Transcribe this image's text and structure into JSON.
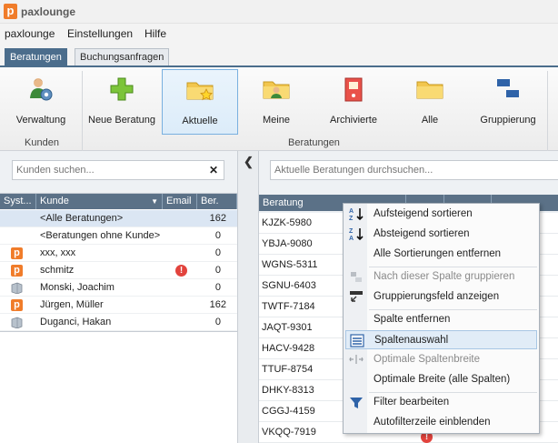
{
  "app": {
    "title": "paxlounge",
    "icon_letter": "p"
  },
  "menu": [
    "paxlounge",
    "Einstellungen",
    "Hilfe"
  ],
  "tabs": [
    {
      "label": "Beratungen",
      "active": true
    },
    {
      "label": "Buchungsanfragen",
      "active": false
    }
  ],
  "ribbon": {
    "buttons": [
      {
        "label": "Verwaltung",
        "icon": "user-gear-icon"
      },
      {
        "label": "Neue Beratung",
        "icon": "green-plus-icon"
      },
      {
        "label": "Aktuelle",
        "icon": "folder-star-icon",
        "selected": true
      },
      {
        "label": "Meine",
        "icon": "folder-person-icon"
      },
      {
        "label": "Archivierte",
        "icon": "binder-icon"
      },
      {
        "label": "Alle",
        "icon": "folder-icon"
      },
      {
        "label": "Gruppierung",
        "icon": "grouping-icon"
      }
    ],
    "groups": [
      "Kunden",
      "Beratungen"
    ]
  },
  "customers": {
    "search_placeholder": "Kunden suchen...",
    "columns": [
      "Syst...",
      "Kunde",
      "Email",
      "Ber."
    ],
    "rows": [
      {
        "system": "",
        "name": "<Alle Beratungen>",
        "email_warning": false,
        "count": "162"
      },
      {
        "system": "",
        "name": "<Beratungen ohne Kunde>",
        "email_warning": false,
        "count": "0"
      },
      {
        "system": "paxlounge",
        "name": "xxx, xxx",
        "email_warning": false,
        "count": "0"
      },
      {
        "system": "paxlounge",
        "name": "schmitz",
        "email_warning": true,
        "count": "0"
      },
      {
        "system": "other",
        "name": "Monski, Joachim",
        "email_warning": false,
        "count": "0"
      },
      {
        "system": "paxlounge",
        "name": "Jürgen, Müller",
        "email_warning": false,
        "count": "162"
      },
      {
        "system": "other",
        "name": "Duganci, Hakan",
        "email_warning": false,
        "count": "0"
      }
    ]
  },
  "consultations": {
    "search_placeholder": "Aktuelle Beratungen durchsuchen...",
    "columns": [
      "Beratung"
    ],
    "rows": [
      "KJZK-5980",
      "YBJA-9080",
      "WGNS-5311",
      "SGNU-6403",
      "TWTF-7184",
      "JAQT-9301",
      "HACV-9428",
      "TTUF-8754",
      "DHKY-8313",
      "CGGJ-4159",
      "VKQQ-7919"
    ]
  },
  "context_menu": {
    "items": [
      {
        "label": "Aufsteigend sortieren",
        "icon": "sort-ascending-icon",
        "disabled": false
      },
      {
        "label": "Absteigend sortieren",
        "icon": "sort-descending-icon",
        "disabled": false
      },
      {
        "label": "Alle Sortierungen entfernen",
        "icon": "",
        "disabled": false
      },
      {
        "label": "Nach dieser Spalte gruppieren",
        "icon": "group-by-column-icon",
        "disabled": true
      },
      {
        "label": "Gruppierungsfeld anzeigen",
        "icon": "group-panel-icon",
        "disabled": false
      },
      {
        "label": "Spalte entfernen",
        "icon": "",
        "disabled": false
      },
      {
        "label": "Spaltenauswahl",
        "icon": "column-chooser-icon",
        "disabled": false,
        "highlighted": true
      },
      {
        "label": "Optimale Spaltenbreite",
        "icon": "best-fit-icon",
        "disabled": true
      },
      {
        "label": "Optimale Breite (alle Spalten)",
        "icon": "",
        "disabled": false
      },
      {
        "label": "Filter bearbeiten",
        "icon": "filter-icon",
        "disabled": false
      },
      {
        "label": "Autofilterzeile einblenden",
        "icon": "",
        "disabled": false
      }
    ]
  },
  "colors": {
    "accent": "#4b6d8c",
    "header": "#5b7187",
    "brand_orange": "#f07c2a",
    "warning": "#e2433d"
  }
}
